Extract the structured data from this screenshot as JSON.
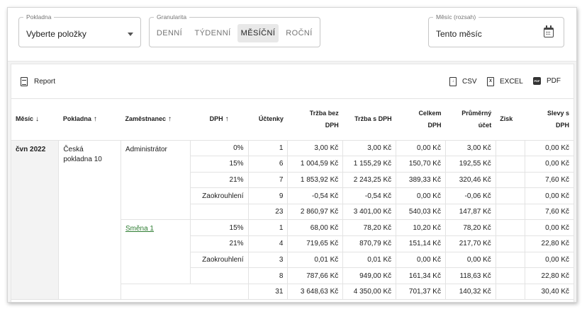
{
  "filters": {
    "pokladna": {
      "label": "Pokladna",
      "value": "Vyberte položky"
    },
    "granularita": {
      "label": "Granularita",
      "options": [
        "DENNÍ",
        "TÝDENNÍ",
        "MĚSÍČNÍ",
        "ROČNÍ"
      ],
      "active": "MĚSÍČNÍ"
    },
    "mesic": {
      "label": "Měsíc (rozsah)",
      "value": "Tento měsíc"
    }
  },
  "toolbar": {
    "report": "Report",
    "csv": "CSV",
    "excel": "EXCEL",
    "pdf": "PDF"
  },
  "table": {
    "headers": {
      "mesic": "Měsíc",
      "pokladna": "Pokladna",
      "zamestnanec": "Zaměstnanec",
      "dph": "DPH",
      "uctenky": "Účtenky",
      "trzba_bez_1": "Tržba bez",
      "trzba_bez_2": "DPH",
      "trzba_s": "Tržba s DPH",
      "celkem_1": "Celkem",
      "celkem_2": "DPH",
      "prumer_1": "Průměrný",
      "prumer_2": "účet",
      "zisk": "Zisk",
      "slevy_1": "Slevy s",
      "slevy_2": "DPH"
    },
    "month": "čvn 2022",
    "register_1": "Česká",
    "register_2": "pokladna 10",
    "groups": [
      {
        "employee": "Administrátor",
        "rows": [
          [
            "0%",
            "1",
            "3,00 Kč",
            "3,00 Kč",
            "0,00 Kč",
            "3,00 Kč",
            "",
            "0,00 Kč"
          ],
          [
            "15%",
            "6",
            "1 004,59 Kč",
            "1 155,29 Kč",
            "150,70 Kč",
            "192,55 Kč",
            "",
            "0,00 Kč"
          ],
          [
            "21%",
            "7",
            "1 853,92 Kč",
            "2 243,25 Kč",
            "389,33 Kč",
            "320,46 Kč",
            "",
            "7,60 Kč"
          ],
          [
            "Zaokrouhlení",
            "9",
            "-0,54 Kč",
            "-0,54 Kč",
            "0,00 Kč",
            "-0,06 Kč",
            "",
            "0,00 Kč"
          ]
        ],
        "total": [
          "23",
          "2 860,97 Kč",
          "3 401,00 Kč",
          "540,03 Kč",
          "147,87 Kč",
          "",
          "7,60 Kč"
        ]
      },
      {
        "employee": "Směna 1",
        "rows": [
          [
            "15%",
            "1",
            "68,00 Kč",
            "78,20 Kč",
            "10,20 Kč",
            "78,20 Kč",
            "",
            "0,00 Kč"
          ],
          [
            "21%",
            "4",
            "719,65 Kč",
            "870,79 Kč",
            "151,14 Kč",
            "217,70 Kč",
            "",
            "22,80 Kč"
          ],
          [
            "Zaokrouhlení",
            "3",
            "0,01 Kč",
            "0,01 Kč",
            "0,00 Kč",
            "0,00 Kč",
            "",
            "0,00 Kč"
          ]
        ],
        "total": [
          "8",
          "787,66 Kč",
          "949,00 Kč",
          "161,34 Kč",
          "118,63 Kč",
          "",
          "22,80 Kč"
        ]
      }
    ],
    "grand_total": [
      "31",
      "3 648,63 Kč",
      "4 350,00 Kč",
      "701,37 Kč",
      "140,32 Kč",
      "",
      "30,40 Kč"
    ]
  }
}
